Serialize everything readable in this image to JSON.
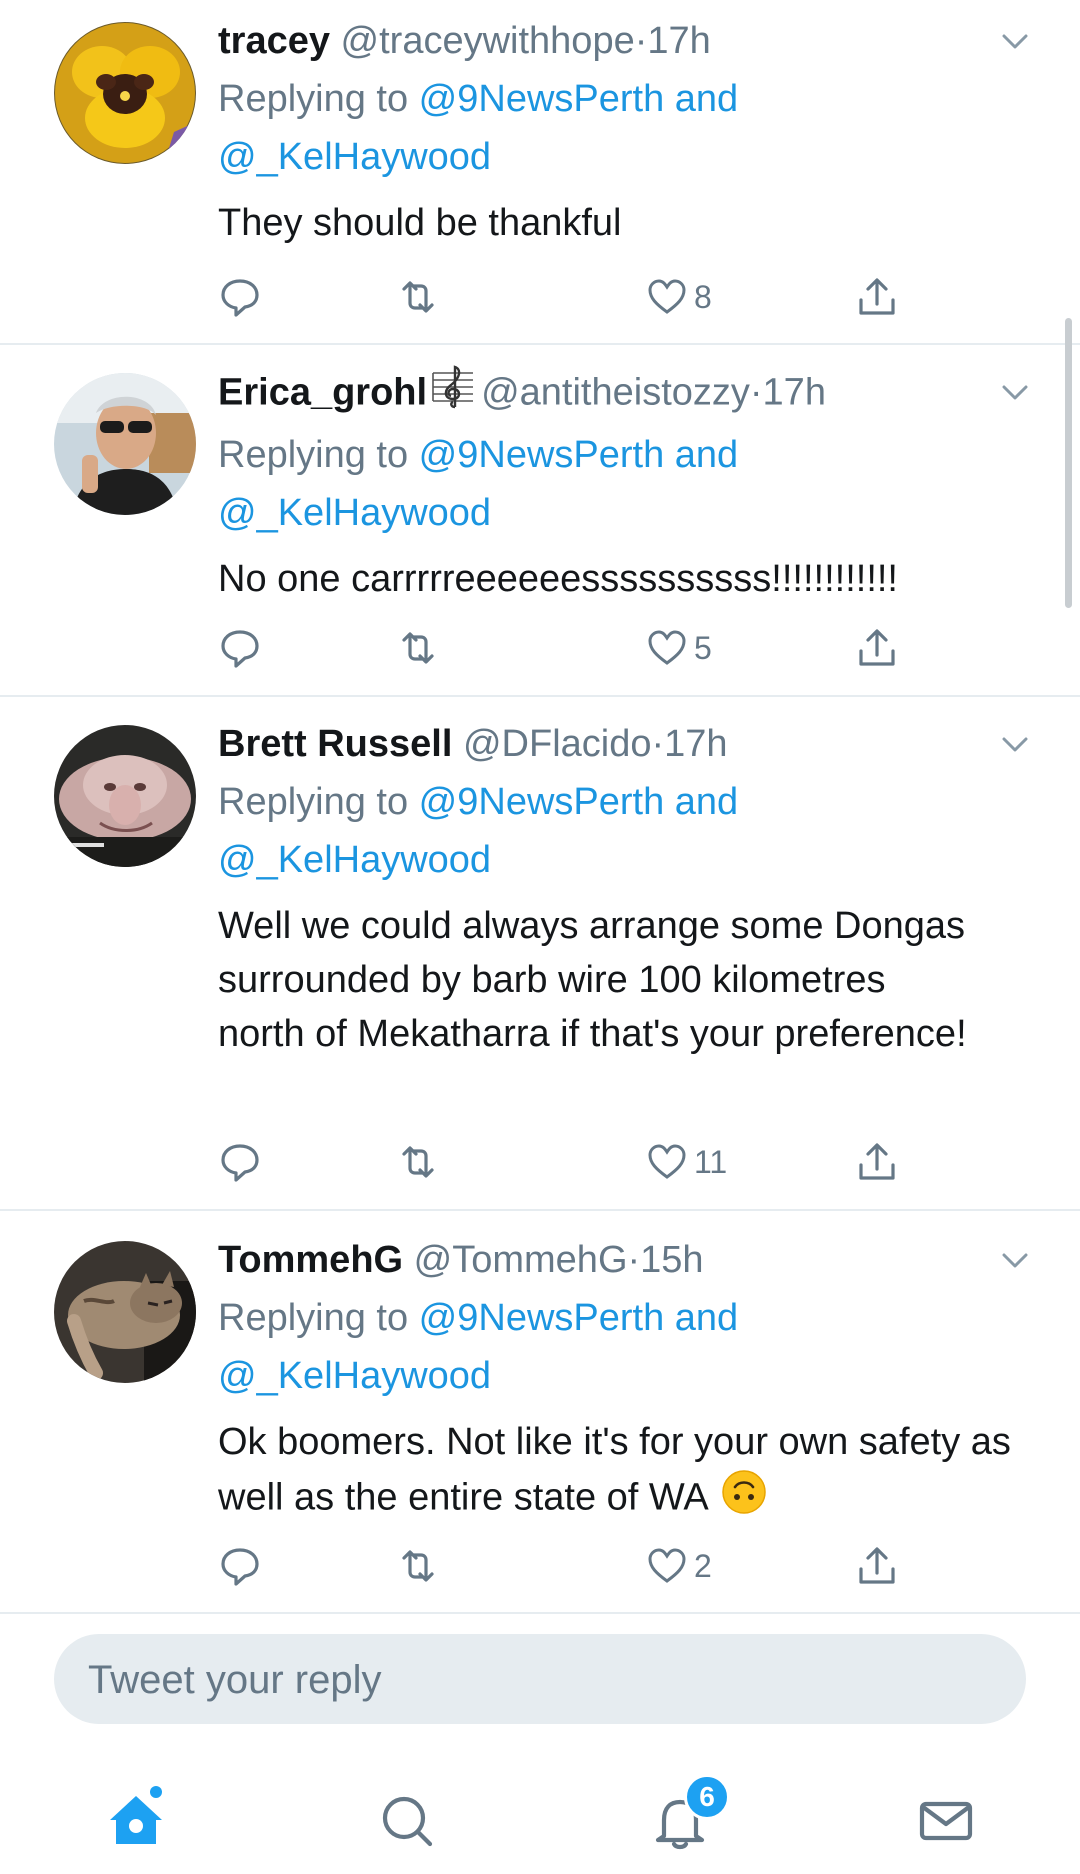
{
  "tweets": [
    {
      "display_name": "tracey",
      "handle": "@traceywithhope",
      "separator": "·",
      "time": "17h",
      "replying_prefix": "Replying to ",
      "mention_1": "@9NewsPerth",
      "mention_joiner": " and",
      "mention_2": "@_KelHaywood",
      "text": "They should be thankful",
      "likes": "8",
      "avatar_icon": "yellow-pansy-flower"
    },
    {
      "display_name": "Erica_grohl",
      "handle": "@antitheistozzy",
      "separator": "·",
      "time": "17h",
      "name_icon": "treble-clef-music-icon",
      "replying_prefix": "Replying to ",
      "mention_1": "@9NewsPerth",
      "mention_joiner": " and",
      "mention_2": "@_KelHaywood",
      "text": "No one carrrrreeeeeessssssssss!!!!!!!!!!!!",
      "likes": "5",
      "avatar_icon": "woman-with-sunglasses"
    },
    {
      "display_name": "Brett Russell",
      "handle": "@DFlacido",
      "separator": "·",
      "time": "17h",
      "replying_prefix": "Replying to ",
      "mention_1": "@9NewsPerth",
      "mention_joiner": " and",
      "mention_2": "@_KelHaywood",
      "text": "Well we could always arrange some Dongas surrounded by barb wire 100 kilometres north of Mekatharra if that's your preference!",
      "likes": "11",
      "avatar_icon": "blobfish"
    },
    {
      "display_name": "TommehG",
      "handle": "@TommehG",
      "separator": "·",
      "time": "15h",
      "replying_prefix": "Replying to ",
      "mention_1": "@9NewsPerth",
      "mention_joiner": " and",
      "mention_2": "@_KelHaywood",
      "text": "Ok boomers. Not like it's for your own safety as well as the entire state of WA",
      "emoji": "upside-down-face",
      "likes": "2",
      "avatar_icon": "sleeping-cat"
    }
  ],
  "composer": {
    "placeholder": "Tweet your reply"
  },
  "tabbar": {
    "items": [
      "home-icon",
      "search-icon",
      "notifications-icon",
      "messages-icon"
    ],
    "notifications_badge": "6"
  },
  "colors": {
    "accent": "#1da1f2",
    "link": "#1b95e0",
    "secondary_text": "#657786",
    "divider": "#e6ecf0"
  }
}
